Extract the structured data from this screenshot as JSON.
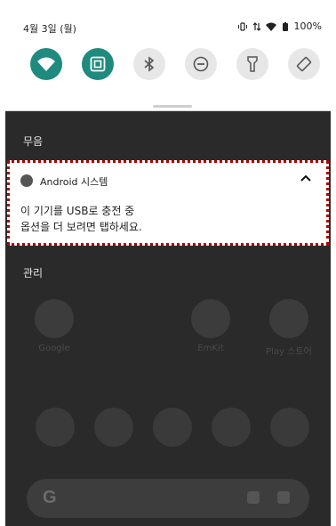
{
  "status_bar": {
    "date": "4월 3일 (월)",
    "battery": "100%",
    "icons": [
      "vibrate-icon",
      "data-arrows-icon",
      "wifi-icon",
      "battery-icon"
    ]
  },
  "quick_settings": {
    "tiles": [
      {
        "name": "wifi",
        "icon": "wifi-icon",
        "active": true
      },
      {
        "name": "nfc",
        "icon": "nfc-icon",
        "active": true
      },
      {
        "name": "bluetooth",
        "icon": "bluetooth-icon",
        "active": false
      },
      {
        "name": "do-not-disturb",
        "icon": "dnd-icon",
        "active": false
      },
      {
        "name": "flashlight",
        "icon": "flashlight-icon",
        "active": false
      },
      {
        "name": "auto-rotate",
        "icon": "rotate-icon",
        "active": false
      }
    ],
    "accent": "#1f8a7e"
  },
  "sections": {
    "silent": "무음",
    "manage": "관리"
  },
  "notification": {
    "app_name": "Android 시스템",
    "title": "이 기기를 USB로 충전 중",
    "text": "옵션을 더 보려면 탭하세요.",
    "highlight_color": "#b00000"
  },
  "home": {
    "apps": [
      {
        "label": "Google"
      },
      {
        "label": "EmKit"
      },
      {
        "label": "Play 스토어"
      }
    ]
  }
}
